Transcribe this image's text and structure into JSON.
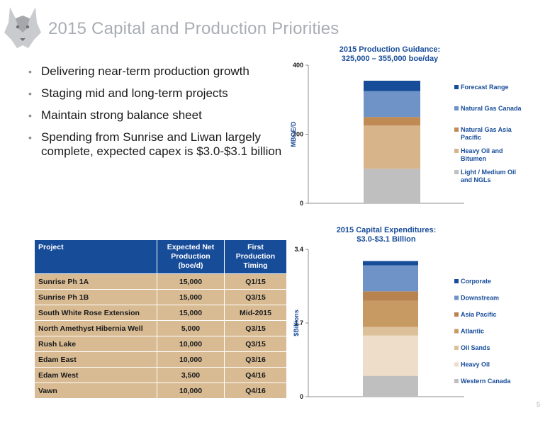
{
  "slide": {
    "title": "2015 Capital and Production Priorities",
    "page_number": "5"
  },
  "bullets": [
    "Delivering near-term production growth",
    "Staging mid and long-term projects",
    "Maintain strong balance sheet",
    "Spending from Sunrise and Liwan largely complete, expected capex is $3.0-$3.1 billion"
  ],
  "table": {
    "headers": [
      "Project",
      "Expected Net Production (boe/d)",
      "First Production Timing"
    ],
    "rows": [
      [
        "Sunrise Ph 1A",
        "15,000",
        "Q1/15"
      ],
      [
        "Sunrise Ph 1B",
        "15,000",
        "Q3/15"
      ],
      [
        "South White Rose Extension",
        "15,000",
        "Mid-2015"
      ],
      [
        "North Amethyst Hibernia Well",
        "5,000",
        "Q3/15"
      ],
      [
        "Rush Lake",
        "10,000",
        "Q3/15"
      ],
      [
        "Edam East",
        "10,000",
        "Q3/16"
      ],
      [
        "Edam West",
        "3,500",
        "Q4/16"
      ],
      [
        "Vawn",
        "10,000",
        "Q4/16"
      ]
    ],
    "header_color": "#174c99",
    "row_color": "#d8bb93"
  },
  "chart_data": [
    {
      "type": "bar",
      "stacked": true,
      "title": "2015 Production Guidance:",
      "subtitle": "325,000 – 355,000 boe/day",
      "ylabel": "MBOE/D",
      "ylim": [
        0,
        400
      ],
      "yticks": [
        0,
        200,
        400
      ],
      "legend_position": "right",
      "series": [
        {
          "name": "Light / Medium Oil and NGLs",
          "value": 100,
          "color": "#bfbfbf"
        },
        {
          "name": "Heavy Oil and Bitumen",
          "value": 125,
          "color": "#d8b48a"
        },
        {
          "name": "Natural Gas Asia Pacific",
          "value": 25,
          "color": "#c08a55"
        },
        {
          "name": "Natural Gas Canada",
          "value": 75,
          "color": "#6f93c7"
        },
        {
          "name": "Forecast Range",
          "value": 30,
          "color": "#174c99"
        }
      ]
    },
    {
      "type": "bar",
      "stacked": true,
      "title": "2015 Capital Expenditures:",
      "subtitle": "$3.0-$3.1 Billion",
      "ylabel": "$Billions",
      "ylim": [
        0,
        3.4
      ],
      "yticks": [
        0,
        1.7,
        3.4
      ],
      "legend_position": "right",
      "series": [
        {
          "name": "Western Canada",
          "value": 0.48,
          "color": "#bfbfbf"
        },
        {
          "name": "Heavy Oil",
          "value": 0.93,
          "color": "#eeddc8"
        },
        {
          "name": "Oil Sands",
          "value": 0.2,
          "color": "#dcc09a"
        },
        {
          "name": "Atlantic",
          "value": 0.6,
          "color": "#c89a63"
        },
        {
          "name": "Asia Pacific",
          "value": 0.22,
          "color": "#b8834f"
        },
        {
          "name": "Downstream",
          "value": 0.6,
          "color": "#6f93c7"
        },
        {
          "name": "Corporate",
          "value": 0.1,
          "color": "#174c99"
        }
      ]
    }
  ]
}
